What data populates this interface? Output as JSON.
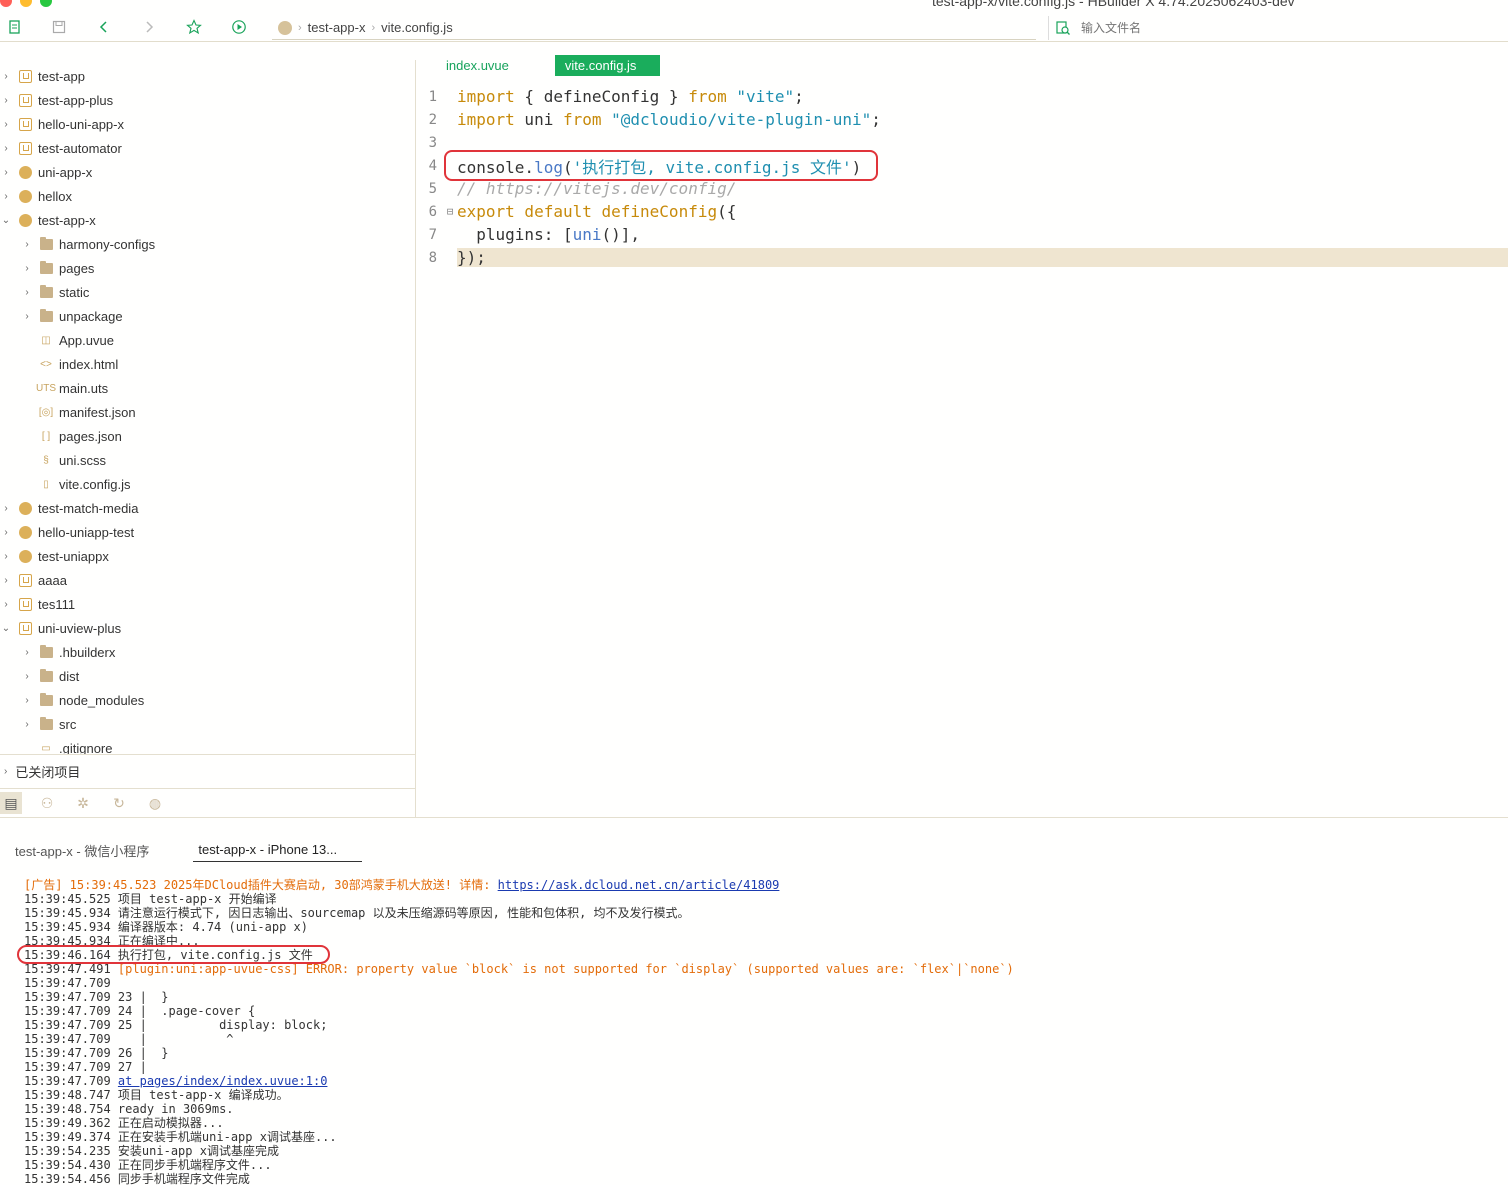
{
  "window": {
    "title": "test-app-x/vite.config.js - HBuilder X 4.74.2025062403-dev"
  },
  "toolbar": {
    "icons": [
      "new-file-icon",
      "save-icon",
      "back-icon",
      "forward-icon",
      "star-icon",
      "run-icon"
    ],
    "breadcrumb": [
      "test-app-x",
      "vite.config.js"
    ],
    "search_placeholder": "输入文件名"
  },
  "sidebar": {
    "tree": [
      {
        "label": "test-app",
        "level": 0,
        "expanded": false,
        "icon": "project-square-icon"
      },
      {
        "label": "test-app-plus",
        "level": 0,
        "expanded": false,
        "icon": "project-square-icon"
      },
      {
        "label": "hello-uni-app-x",
        "level": 0,
        "expanded": false,
        "icon": "project-square-icon"
      },
      {
        "label": "test-automator",
        "level": 0,
        "expanded": false,
        "icon": "project-square-icon"
      },
      {
        "label": "uni-app-x",
        "level": 0,
        "expanded": false,
        "icon": "project-round-icon"
      },
      {
        "label": "hellox",
        "level": 0,
        "expanded": false,
        "icon": "project-round-icon"
      },
      {
        "label": "test-app-x",
        "level": 0,
        "expanded": true,
        "icon": "project-round-icon"
      },
      {
        "label": "harmony-configs",
        "level": 1,
        "expanded": false,
        "icon": "folder-icon"
      },
      {
        "label": "pages",
        "level": 1,
        "expanded": false,
        "icon": "folder-icon"
      },
      {
        "label": "static",
        "level": 1,
        "expanded": false,
        "icon": "folder-icon"
      },
      {
        "label": "unpackage",
        "level": 1,
        "expanded": false,
        "icon": "folder-icon"
      },
      {
        "label": "App.uvue",
        "level": 1,
        "icon": "uvue-file-icon"
      },
      {
        "label": "index.html",
        "level": 1,
        "icon": "html-file-icon"
      },
      {
        "label": "main.uts",
        "level": 1,
        "icon": "uts-file-icon"
      },
      {
        "label": "manifest.json",
        "level": 1,
        "icon": "manifest-file-icon"
      },
      {
        "label": "pages.json",
        "level": 1,
        "icon": "json-file-icon"
      },
      {
        "label": "uni.scss",
        "level": 1,
        "icon": "scss-file-icon"
      },
      {
        "label": "vite.config.js",
        "level": 1,
        "icon": "js-file-icon"
      },
      {
        "label": "test-match-media",
        "level": 0,
        "expanded": false,
        "icon": "project-round-icon"
      },
      {
        "label": "hello-uniapp-test",
        "level": 0,
        "expanded": false,
        "icon": "project-round-icon"
      },
      {
        "label": "test-uniappx",
        "level": 0,
        "expanded": false,
        "icon": "project-round-icon"
      },
      {
        "label": "aaaa",
        "level": 0,
        "expanded": false,
        "icon": "project-square-icon"
      },
      {
        "label": "tes111",
        "level": 0,
        "expanded": false,
        "icon": "project-square-icon"
      },
      {
        "label": "uni-uview-plus",
        "level": 0,
        "expanded": true,
        "icon": "project-square-icon"
      },
      {
        "label": ".hbuilderx",
        "level": 1,
        "expanded": false,
        "icon": "folder-icon"
      },
      {
        "label": "dist",
        "level": 1,
        "expanded": false,
        "icon": "folder-icon"
      },
      {
        "label": "node_modules",
        "level": 1,
        "expanded": false,
        "icon": "folder-icon"
      },
      {
        "label": "src",
        "level": 1,
        "expanded": false,
        "icon": "folder-icon"
      },
      {
        "label": ".gitignore",
        "level": 1,
        "icon": "file-icon"
      }
    ],
    "closed_projects_label": "已关闭项目",
    "bottom_tabs": [
      "project-manager-icon",
      "debug-icon",
      "bug-icon",
      "git-icon",
      "plugin-icon"
    ]
  },
  "editor": {
    "tabs": [
      {
        "label": "index.uvue",
        "active": false
      },
      {
        "label": "vite.config.js",
        "active": true
      }
    ],
    "lines": [
      {
        "num": "1",
        "fold": "",
        "html_tokens": [
          [
            "kw",
            "import"
          ],
          [
            "plain",
            " { defineConfig } "
          ],
          [
            "kw",
            "from"
          ],
          [
            "plain",
            " "
          ],
          [
            "str",
            "\"vite\""
          ],
          [
            "plain",
            ";"
          ]
        ]
      },
      {
        "num": "2",
        "fold": "",
        "html_tokens": [
          [
            "kw",
            "import"
          ],
          [
            "plain",
            " uni "
          ],
          [
            "kw",
            "from"
          ],
          [
            "plain",
            " "
          ],
          [
            "str",
            "\"@dcloudio/vite-plugin-uni\""
          ],
          [
            "plain",
            ";"
          ]
        ]
      },
      {
        "num": "3",
        "fold": "",
        "html_tokens": []
      },
      {
        "num": "4",
        "fold": "",
        "html_tokens": [
          [
            "plain",
            "console."
          ],
          [
            "fn",
            "log"
          ],
          [
            "plain",
            "("
          ],
          [
            "str",
            "'执行打包, vite.config.js 文件'"
          ],
          [
            "plain",
            ")"
          ]
        ]
      },
      {
        "num": "5",
        "fold": "",
        "html_tokens": [
          [
            "cmt",
            "// https://vitejs.dev/config/"
          ]
        ]
      },
      {
        "num": "6",
        "fold": "⊟",
        "html_tokens": [
          [
            "kw",
            "export default "
          ],
          [
            "kw",
            "defineConfig"
          ],
          [
            "plain",
            "({"
          ]
        ]
      },
      {
        "num": "7",
        "fold": "",
        "html_tokens": [
          [
            "plain",
            "  plugins: ["
          ],
          [
            "fn",
            "uni"
          ],
          [
            "plain",
            "()],"
          ]
        ]
      },
      {
        "num": "8",
        "fold": "",
        "html_tokens": [
          [
            "plain",
            "});"
          ]
        ],
        "highlighted": true
      }
    ]
  },
  "console": {
    "tabs": [
      {
        "label": "test-app-x - 微信小程序",
        "active": false
      },
      {
        "label": "test-app-x - iPhone 13...",
        "active": true
      }
    ],
    "lines": [
      {
        "type": "ad",
        "prefix": "[广告] 15:39:45.523 2025年DCloud插件大赛启动, 30部鸿蒙手机大放送! 详情: ",
        "link": "https://ask.dcloud.net.cn/article/41809"
      },
      {
        "type": "normal",
        "text": "15:39:45.525 项目 test-app-x 开始编译"
      },
      {
        "type": "normal",
        "text": "15:39:45.934 请注意运行模式下, 因日志输出、sourcemap 以及未压缩源码等原因, 性能和包体积, 均不及发行模式。"
      },
      {
        "type": "normal",
        "text": "15:39:45.934 编译器版本: 4.74 (uni-app x)"
      },
      {
        "type": "normal",
        "text": "15:39:45.934 正在编译中..."
      },
      {
        "type": "normal",
        "text": "15:39:46.164 执行打包, vite.config.js 文件"
      },
      {
        "type": "error",
        "time": "15:39:47.491 ",
        "text": "[plugin:uni:app-uvue-css] ERROR: property value `block` is not supported for `display` (supported values are: `flex`|`none`)"
      },
      {
        "type": "normal",
        "text": "15:39:47.709"
      },
      {
        "type": "normal",
        "text": "15:39:47.709 23 |  }"
      },
      {
        "type": "normal",
        "text": "15:39:47.709 24 |  .page-cover {"
      },
      {
        "type": "normal",
        "text": "15:39:47.709 25 |          display: block;"
      },
      {
        "type": "normal",
        "text": "15:39:47.709    |           ^"
      },
      {
        "type": "normal",
        "text": "15:39:47.709 26 |  }"
      },
      {
        "type": "normal",
        "text": "15:39:47.709 27 |"
      },
      {
        "type": "link",
        "time": "15:39:47.709 ",
        "link": "at pages/index/index.uvue:1:0"
      },
      {
        "type": "normal",
        "text": "15:39:48.747 项目 test-app-x 编译成功。"
      },
      {
        "type": "normal",
        "text": "15:39:48.754 ready in 3069ms."
      },
      {
        "type": "normal",
        "text": "15:39:49.362 正在启动模拟器..."
      },
      {
        "type": "normal",
        "text": "15:39:49.374 正在安装手机端uni-app x调试基座..."
      },
      {
        "type": "normal",
        "text": "15:39:54.235 安装uni-app x调试基座完成"
      },
      {
        "type": "normal",
        "text": "15:39:54.430 正在同步手机端程序文件..."
      },
      {
        "type": "normal",
        "text": "15:39:54.456 同步手机端程序文件完成"
      }
    ]
  },
  "colors": {
    "accent_green": "#1aad5c",
    "annotation_red": "#e0343a",
    "ad_orange": "#e36c0a",
    "keyword": "#c78a0a",
    "string": "#1f8fb0"
  }
}
